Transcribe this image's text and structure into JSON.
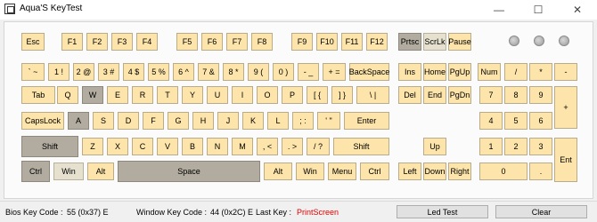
{
  "window": {
    "title": "Aqua'S KeyTest",
    "minimize": "—",
    "maximize": "☐",
    "close": "✕"
  },
  "keys": {
    "esc": "Esc",
    "f1": "F1",
    "f2": "F2",
    "f3": "F3",
    "f4": "F4",
    "f5": "F5",
    "f6": "F6",
    "f7": "F7",
    "f8": "F8",
    "f9": "F9",
    "f10": "F10",
    "f11": "F11",
    "f12": "F12",
    "prtsc": "Prtsc",
    "scrlk": "ScrLk",
    "pause": "Pause",
    "backtick": "` ~",
    "1": "1 !",
    "2": "2 @",
    "3": "3 #",
    "4": "4 $",
    "5": "5 %",
    "6": "6 ^",
    "7": "7 &",
    "8": "8 *",
    "9": "9 (",
    "0": "0 )",
    "minus": "- _",
    "equals": "+ =",
    "backspace": "BackSpace",
    "ins": "Ins",
    "home": "Home",
    "pgup": "PgUp",
    "numlock": "Num",
    "numdiv": "/",
    "nummul": "*",
    "numsub": "-",
    "tab": "Tab",
    "q": "Q",
    "w": "W",
    "e": "E",
    "r": "R",
    "t": "T",
    "y": "Y",
    "u": "U",
    "i": "I",
    "o": "O",
    "p": "P",
    "lbracket": "[ {",
    "rbracket": "] }",
    "backslash": "\\ |",
    "del": "Del",
    "end": "End",
    "pgdn": "PgDn",
    "num7": "7",
    "num8": "8",
    "num9": "9",
    "numadd": "+",
    "capslock": "CapsLock",
    "a": "A",
    "s": "S",
    "d": "D",
    "f": "F",
    "g": "G",
    "h": "H",
    "j": "J",
    "k": "K",
    "l": "L",
    "semicolon": "; :",
    "quote": "' \"",
    "enter": "Enter",
    "num4": "4",
    "num5": "5",
    "num6": "6",
    "lshift": "Shift",
    "z": "Z",
    "x": "X",
    "c": "C",
    "v": "V",
    "b": "B",
    "n": "N",
    "m": "M",
    "comma": ", <",
    "period": ". >",
    "slash": "/ ?",
    "rshift": "Shift",
    "up": "Up",
    "num1": "1",
    "num2": "2",
    "num3": "3",
    "lctrl": "Ctrl",
    "lwin": "Win",
    "lalt": "Alt",
    "space": "Space",
    "ralt": "Alt",
    "rwin": "Win",
    "menu": "Menu",
    "rctrl": "Ctrl",
    "left": "Left",
    "down": "Down",
    "right": "Right",
    "num0": "0",
    "numdot": ".",
    "numenter": "Ent"
  },
  "status": {
    "bios_label": "Bios Key Code :",
    "bios_value": "55 (0x37) E",
    "window_label": "Window Key Code :",
    "window_value": "44 (0x2C) E",
    "last_label": "Last Key :",
    "last_value": "PrintScreen",
    "led_test": "Led Test",
    "clear": "Clear"
  },
  "colors": {
    "key": "#fce4aa",
    "pressed": "#b2ab9f",
    "highlight": "#e6e1cf",
    "last_key": "#e00000"
  }
}
